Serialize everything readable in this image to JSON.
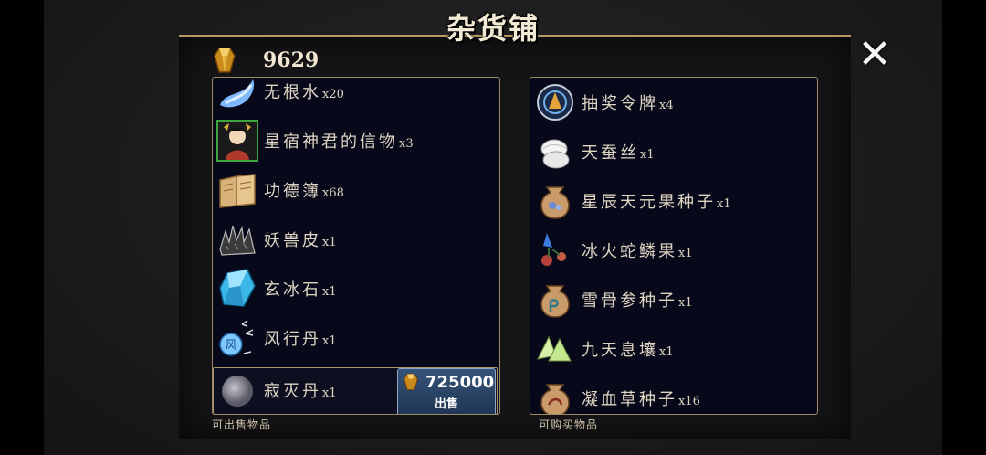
{
  "title": "杂货铺",
  "currency": {
    "icon": "gold-gem-icon",
    "amount": "9629"
  },
  "close_label": "✕",
  "sell_panel": {
    "caption": "可出售物品",
    "items": [
      {
        "name": "无根水",
        "qty": "x20",
        "icon": "water-icon"
      },
      {
        "name": "星宿神君的信物",
        "qty": "x3",
        "icon": "portrait-token-icon"
      },
      {
        "name": "功德簿",
        "qty": "x68",
        "icon": "book-icon"
      },
      {
        "name": "妖兽皮",
        "qty": "x1",
        "icon": "fur-icon"
      },
      {
        "name": "玄冰石",
        "qty": "x1",
        "icon": "ice-crystal-icon"
      },
      {
        "name": "风行丹",
        "qty": "x1",
        "icon": "wind-pill-icon"
      },
      {
        "name": "寂灭丹",
        "qty": "x1",
        "icon": "grey-pill-icon"
      }
    ],
    "sell_button": {
      "price": "725000",
      "label": "出售"
    }
  },
  "buy_panel": {
    "caption": "可购买物品",
    "items": [
      {
        "name": "抽奖令牌",
        "qty": "x4",
        "icon": "lottery-token-icon"
      },
      {
        "name": "天蚕丝",
        "qty": "x1",
        "icon": "silk-icon"
      },
      {
        "name": "星辰天元果种子",
        "qty": "x1",
        "icon": "seed-bag-icon"
      },
      {
        "name": "冰火蛇鳞果",
        "qty": "x1",
        "icon": "fruit-icon"
      },
      {
        "name": "雪骨参种子",
        "qty": "x1",
        "icon": "seed-bag-icon"
      },
      {
        "name": "九天息壤",
        "qty": "x1",
        "icon": "soil-icon"
      },
      {
        "name": "凝血草种子",
        "qty": "x16",
        "icon": "seed-bag-icon"
      }
    ]
  },
  "colors": {
    "gold": "#d9a63a",
    "panel_bg": "#07091a",
    "border": "#9c8a62",
    "sell_button": "#2a4466"
  }
}
